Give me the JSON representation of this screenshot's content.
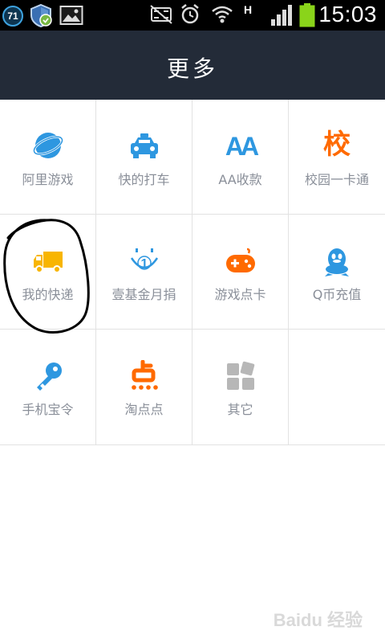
{
  "status_bar": {
    "notification_count": "71",
    "network_type": "H",
    "time": "15:03"
  },
  "header": {
    "title": "更多"
  },
  "grid": {
    "items": [
      {
        "label": "阿里游戏",
        "icon": "ali-games-icon"
      },
      {
        "label": "快的打车",
        "icon": "taxi-icon"
      },
      {
        "label": "AA收款",
        "icon": "aa-icon",
        "glyph": "AA"
      },
      {
        "label": "校园一卡通",
        "icon": "campus-card-icon",
        "glyph": "校"
      },
      {
        "label": "我的快递",
        "icon": "delivery-truck-icon"
      },
      {
        "label": "壹基金月捐",
        "icon": "one-foundation-icon"
      },
      {
        "label": "游戏点卡",
        "icon": "gamepad-icon"
      },
      {
        "label": "Q币充值",
        "icon": "qq-penguin-icon"
      },
      {
        "label": "手机宝令",
        "icon": "key-icon"
      },
      {
        "label": "淘点点",
        "icon": "taodiandian-icon"
      },
      {
        "label": "其它",
        "icon": "other-apps-icon"
      }
    ]
  },
  "watermark": "Baidu 经验",
  "colors": {
    "header_bg": "#232b38",
    "blue": "#2e97e0",
    "orange": "#ff6a00",
    "yellow": "#f8b500",
    "gray": "#b7b7b7"
  }
}
